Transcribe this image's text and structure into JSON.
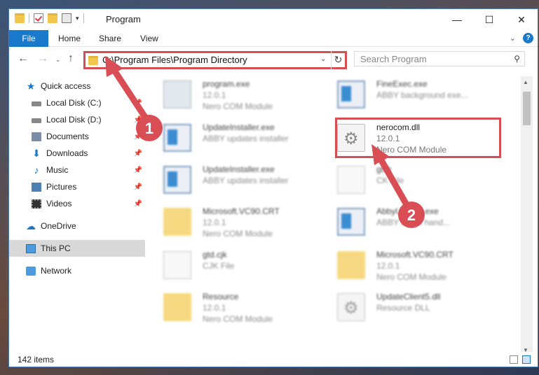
{
  "window": {
    "title": "Program",
    "min": "—",
    "max": "☐",
    "close": "✕"
  },
  "ribbon": {
    "tabs": [
      "File",
      "Home",
      "Share",
      "View"
    ],
    "help": "?",
    "expand": "⌄"
  },
  "nav": {
    "back": "←",
    "forward": "→",
    "recent": "⌄",
    "up": "↑",
    "address": "C:\\Program Files\\Program Directory",
    "address_dropdown": "⌄",
    "refresh": "↻",
    "search_placeholder": "Search Program",
    "search_icon": "⚲"
  },
  "sidebar": {
    "items": [
      {
        "label": "Quick access",
        "icon": "star-icon",
        "glyph": "★",
        "pinned": false
      },
      {
        "label": "Local Disk (C:)",
        "icon": "disk-icon",
        "pinned": true
      },
      {
        "label": "Local Disk (D:)",
        "icon": "disk-icon",
        "pinned": true
      },
      {
        "label": "Documents",
        "icon": "documents-icon",
        "pinned": true
      },
      {
        "label": "Downloads",
        "icon": "download-icon",
        "glyph": "⬇",
        "pinned": true
      },
      {
        "label": "Music",
        "icon": "music-icon",
        "glyph": "♪",
        "pinned": true
      },
      {
        "label": "Pictures",
        "icon": "pictures-icon",
        "pinned": true
      },
      {
        "label": "Videos",
        "icon": "videos-icon",
        "pinned": true
      },
      {
        "label": "OneDrive",
        "icon": "cloud-icon",
        "glyph": "☁",
        "pinned": false
      },
      {
        "label": "This PC",
        "icon": "computer-icon",
        "pinned": false,
        "selected": true
      },
      {
        "label": "Network",
        "icon": "network-icon",
        "pinned": false
      }
    ],
    "pin_glyph": "📌"
  },
  "files": [
    {
      "name": "program.exe",
      "line2": "12.0.1",
      "line3": "Nero COM Module",
      "icon": "exe-icon"
    },
    {
      "name": "FineExec.exe",
      "line2": "ABBY background exe...",
      "line3": "",
      "icon": "window-icon"
    },
    {
      "name": "UpdateInstaller.exe",
      "line2": "ABBY updates installer",
      "line3": "",
      "icon": "window-icon"
    },
    {
      "name": "nerocom.dll",
      "line2": "12.0.1",
      "line3": "Nero COM Module",
      "icon": "gear-file-icon"
    },
    {
      "name": "UpdateInstaller.exe",
      "line2": "ABBY updates installer",
      "line3": "",
      "icon": "window-icon"
    },
    {
      "name": "gtsk",
      "line2": "CK File",
      "line3": "",
      "icon": "document-icon"
    },
    {
      "name": "Microsoft.VC90.CRT",
      "line2": "12.0.1",
      "line3": "Nero COM Module",
      "icon": "folder-icon"
    },
    {
      "name": "AbbyUpdate.exe",
      "line2": "ABBY agent hand...",
      "line3": "",
      "icon": "window-icon"
    },
    {
      "name": "gtd.cjk",
      "line2": "CJK File",
      "line3": "",
      "icon": "document-icon"
    },
    {
      "name": "Microsoft.VC90.CRT",
      "line2": "12.0.1",
      "line3": "Nero COM Module",
      "icon": "folder-icon"
    },
    {
      "name": "Resource",
      "line2": "12.0.1",
      "line3": "Nero COM Module",
      "icon": "folder-icon"
    },
    {
      "name": "UpdateClient5.dll",
      "line2": "Resource DLL",
      "line3": "",
      "icon": "gear-file-icon"
    }
  ],
  "status": {
    "count": "142 items"
  },
  "annotations": {
    "step1": "1",
    "step2": "2",
    "color": "#d94e55"
  }
}
